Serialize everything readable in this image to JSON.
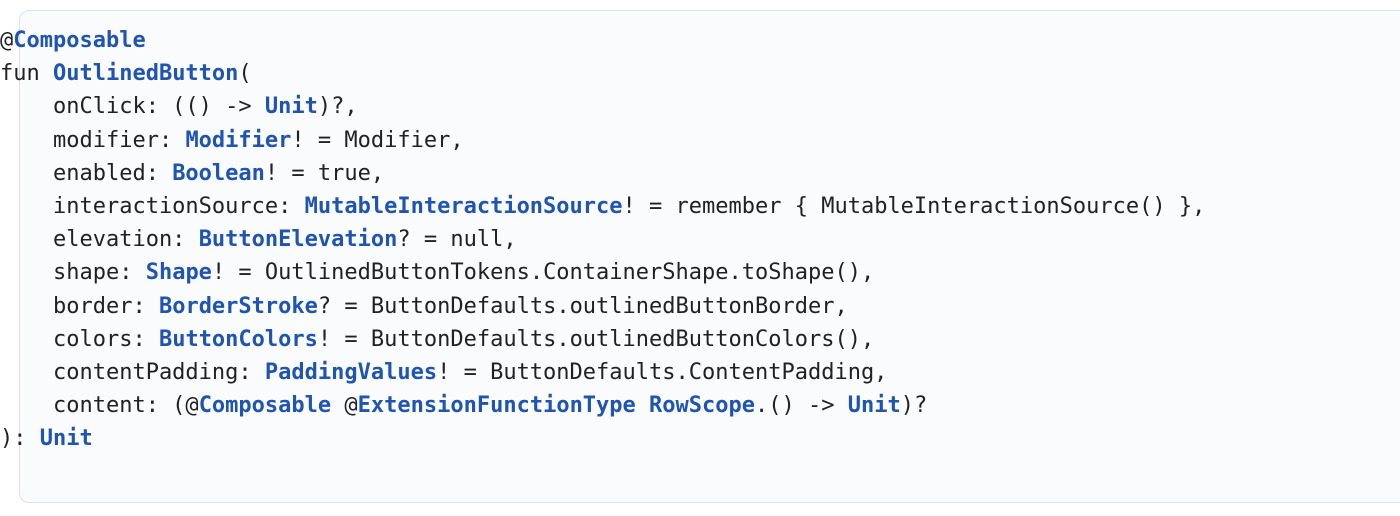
{
  "code_block": {
    "language": "kotlin",
    "colors": {
      "text": "#202124",
      "keyword": "#1f54b0",
      "background": "#fafbfc",
      "border": "#dde1e6"
    },
    "lines": [
      [
        {
          "t": "@",
          "k": false
        },
        {
          "t": "Composable",
          "k": true
        }
      ],
      [
        {
          "t": "fun ",
          "k": false
        },
        {
          "t": "OutlinedButton",
          "k": true
        },
        {
          "t": "(",
          "k": false
        }
      ],
      [
        {
          "t": "    onClick: (() -> ",
          "k": false
        },
        {
          "t": "Unit",
          "k": true
        },
        {
          "t": ")?,",
          "k": false
        }
      ],
      [
        {
          "t": "    modifier: ",
          "k": false
        },
        {
          "t": "Modifier",
          "k": true
        },
        {
          "t": "! = Modifier,",
          "k": false
        }
      ],
      [
        {
          "t": "    enabled: ",
          "k": false
        },
        {
          "t": "Boolean",
          "k": true
        },
        {
          "t": "! = true,",
          "k": false
        }
      ],
      [
        {
          "t": "    interactionSource: ",
          "k": false
        },
        {
          "t": "MutableInteractionSource",
          "k": true
        },
        {
          "t": "! = remember { MutableInteractionSource() },",
          "k": false
        }
      ],
      [
        {
          "t": "    elevation: ",
          "k": false
        },
        {
          "t": "ButtonElevation",
          "k": true
        },
        {
          "t": "? = null,",
          "k": false
        }
      ],
      [
        {
          "t": "    shape: ",
          "k": false
        },
        {
          "t": "Shape",
          "k": true
        },
        {
          "t": "! = OutlinedButtonTokens.ContainerShape.toShape(),",
          "k": false
        }
      ],
      [
        {
          "t": "    border: ",
          "k": false
        },
        {
          "t": "BorderStroke",
          "k": true
        },
        {
          "t": "? = ButtonDefaults.outlinedButtonBorder,",
          "k": false
        }
      ],
      [
        {
          "t": "    colors: ",
          "k": false
        },
        {
          "t": "ButtonColors",
          "k": true
        },
        {
          "t": "! = ButtonDefaults.outlinedButtonColors(),",
          "k": false
        }
      ],
      [
        {
          "t": "    contentPadding: ",
          "k": false
        },
        {
          "t": "PaddingValues",
          "k": true
        },
        {
          "t": "! = ButtonDefaults.ContentPadding,",
          "k": false
        }
      ],
      [
        {
          "t": "    content: (@",
          "k": false
        },
        {
          "t": "Composable",
          "k": true
        },
        {
          "t": " @",
          "k": false
        },
        {
          "t": "ExtensionFunctionType",
          "k": true
        },
        {
          "t": " ",
          "k": false
        },
        {
          "t": "RowScope",
          "k": true
        },
        {
          "t": ".() -> ",
          "k": false
        },
        {
          "t": "Unit",
          "k": true
        },
        {
          "t": ")?",
          "k": false
        }
      ],
      [
        {
          "t": "): ",
          "k": false
        },
        {
          "t": "Unit",
          "k": true
        }
      ]
    ]
  }
}
